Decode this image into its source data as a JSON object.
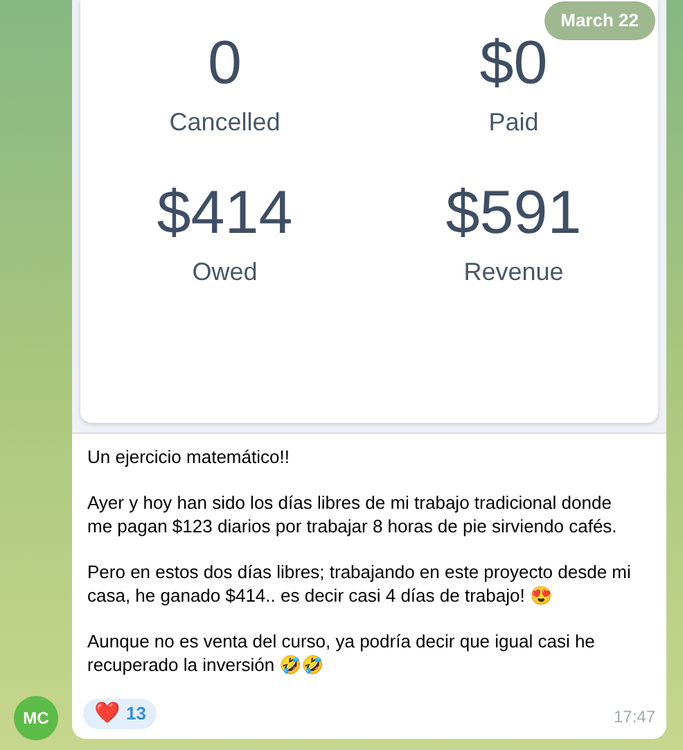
{
  "date_badge": "March 22",
  "stats": [
    {
      "value": "0",
      "label": "Cancelled"
    },
    {
      "value": "$0",
      "label": "Paid"
    },
    {
      "value": "$414",
      "label": "Owed"
    },
    {
      "value": "$591",
      "label": "Revenue"
    }
  ],
  "message": {
    "paragraphs": [
      "Un ejercicio matemático!!",
      "Ayer y hoy han sido los días libres de mi trabajo tradicional donde me pagan $123 diarios por trabajar 8 horas de pie sirviendo cafés.",
      "Pero en estos dos días libres; trabajando en este proyecto desde mi casa, he ganado $414.. es decir casi 4 días de trabajo! 😍",
      "Aunque no es venta del curso, ya podría decir que igual casi he recuperado la inversión 🤣🤣"
    ],
    "reaction": {
      "emoji": "❤️",
      "count": "13"
    },
    "time": "17:47"
  },
  "avatar": {
    "initials": "MC"
  }
}
